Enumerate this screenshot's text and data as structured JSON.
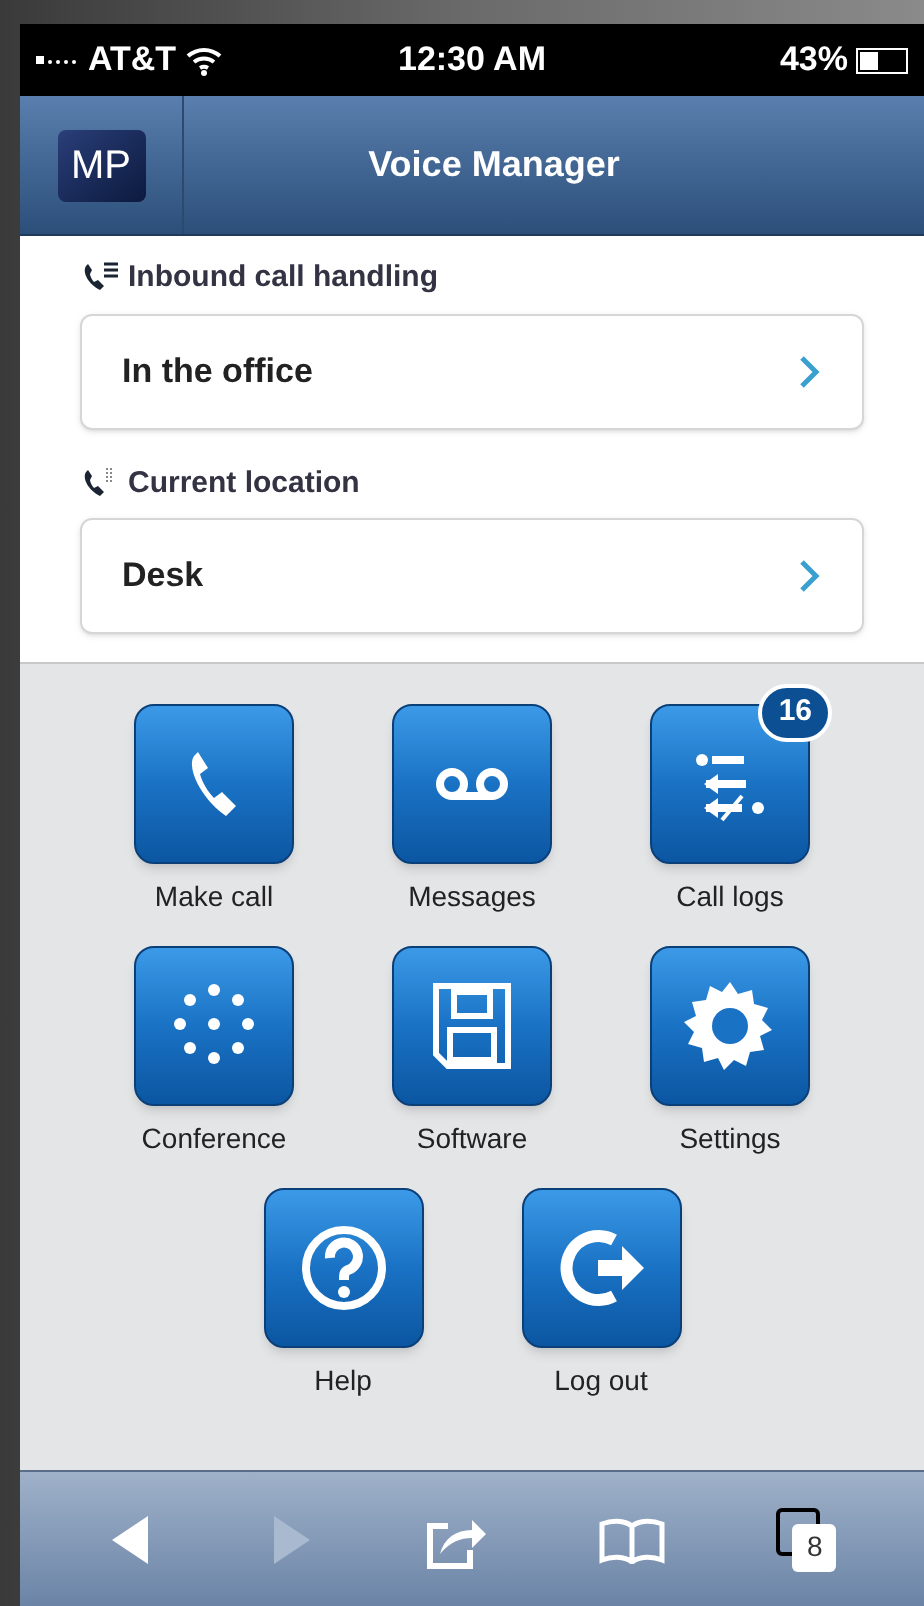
{
  "status_bar": {
    "carrier": "AT&T",
    "time": "12:30 AM",
    "battery": "43%"
  },
  "header": {
    "logo": "MP",
    "title": "Voice Manager"
  },
  "settings": [
    {
      "label": "Inbound call handling",
      "value": "In the office"
    },
    {
      "label": "Current location",
      "value": "Desk"
    }
  ],
  "apps": [
    {
      "label": "Make call"
    },
    {
      "label": "Messages"
    },
    {
      "label": "Call logs",
      "badge": "16"
    },
    {
      "label": "Conference"
    },
    {
      "label": "Software"
    },
    {
      "label": "Settings"
    },
    {
      "label": "Help"
    },
    {
      "label": "Log out"
    }
  ],
  "toolbar": [
    {
      "kind": "back",
      "disabled": false
    },
    {
      "kind": "forward",
      "disabled": true
    },
    {
      "kind": "share",
      "disabled": false
    },
    {
      "kind": "bookmarks",
      "disabled": false
    },
    {
      "kind": "tabs",
      "disabled": false,
      "count": "8"
    }
  ]
}
